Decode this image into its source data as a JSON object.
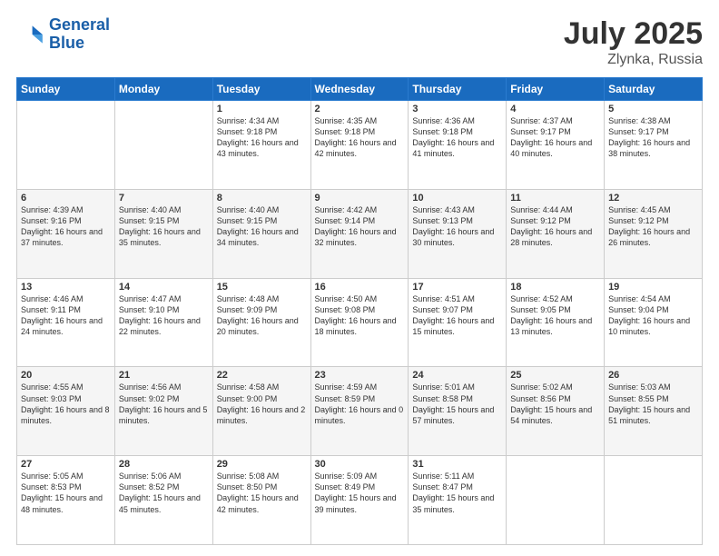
{
  "header": {
    "logo_line1": "General",
    "logo_line2": "Blue",
    "title": "July 2025",
    "location": "Zlynka, Russia"
  },
  "weekdays": [
    "Sunday",
    "Monday",
    "Tuesday",
    "Wednesday",
    "Thursday",
    "Friday",
    "Saturday"
  ],
  "weeks": [
    [
      {
        "day": "",
        "sunrise": "",
        "sunset": "",
        "daylight": ""
      },
      {
        "day": "",
        "sunrise": "",
        "sunset": "",
        "daylight": ""
      },
      {
        "day": "1",
        "sunrise": "Sunrise: 4:34 AM",
        "sunset": "Sunset: 9:18 PM",
        "daylight": "Daylight: 16 hours and 43 minutes."
      },
      {
        "day": "2",
        "sunrise": "Sunrise: 4:35 AM",
        "sunset": "Sunset: 9:18 PM",
        "daylight": "Daylight: 16 hours and 42 minutes."
      },
      {
        "day": "3",
        "sunrise": "Sunrise: 4:36 AM",
        "sunset": "Sunset: 9:18 PM",
        "daylight": "Daylight: 16 hours and 41 minutes."
      },
      {
        "day": "4",
        "sunrise": "Sunrise: 4:37 AM",
        "sunset": "Sunset: 9:17 PM",
        "daylight": "Daylight: 16 hours and 40 minutes."
      },
      {
        "day": "5",
        "sunrise": "Sunrise: 4:38 AM",
        "sunset": "Sunset: 9:17 PM",
        "daylight": "Daylight: 16 hours and 38 minutes."
      }
    ],
    [
      {
        "day": "6",
        "sunrise": "Sunrise: 4:39 AM",
        "sunset": "Sunset: 9:16 PM",
        "daylight": "Daylight: 16 hours and 37 minutes."
      },
      {
        "day": "7",
        "sunrise": "Sunrise: 4:40 AM",
        "sunset": "Sunset: 9:15 PM",
        "daylight": "Daylight: 16 hours and 35 minutes."
      },
      {
        "day": "8",
        "sunrise": "Sunrise: 4:40 AM",
        "sunset": "Sunset: 9:15 PM",
        "daylight": "Daylight: 16 hours and 34 minutes."
      },
      {
        "day": "9",
        "sunrise": "Sunrise: 4:42 AM",
        "sunset": "Sunset: 9:14 PM",
        "daylight": "Daylight: 16 hours and 32 minutes."
      },
      {
        "day": "10",
        "sunrise": "Sunrise: 4:43 AM",
        "sunset": "Sunset: 9:13 PM",
        "daylight": "Daylight: 16 hours and 30 minutes."
      },
      {
        "day": "11",
        "sunrise": "Sunrise: 4:44 AM",
        "sunset": "Sunset: 9:12 PM",
        "daylight": "Daylight: 16 hours and 28 minutes."
      },
      {
        "day": "12",
        "sunrise": "Sunrise: 4:45 AM",
        "sunset": "Sunset: 9:12 PM",
        "daylight": "Daylight: 16 hours and 26 minutes."
      }
    ],
    [
      {
        "day": "13",
        "sunrise": "Sunrise: 4:46 AM",
        "sunset": "Sunset: 9:11 PM",
        "daylight": "Daylight: 16 hours and 24 minutes."
      },
      {
        "day": "14",
        "sunrise": "Sunrise: 4:47 AM",
        "sunset": "Sunset: 9:10 PM",
        "daylight": "Daylight: 16 hours and 22 minutes."
      },
      {
        "day": "15",
        "sunrise": "Sunrise: 4:48 AM",
        "sunset": "Sunset: 9:09 PM",
        "daylight": "Daylight: 16 hours and 20 minutes."
      },
      {
        "day": "16",
        "sunrise": "Sunrise: 4:50 AM",
        "sunset": "Sunset: 9:08 PM",
        "daylight": "Daylight: 16 hours and 18 minutes."
      },
      {
        "day": "17",
        "sunrise": "Sunrise: 4:51 AM",
        "sunset": "Sunset: 9:07 PM",
        "daylight": "Daylight: 16 hours and 15 minutes."
      },
      {
        "day": "18",
        "sunrise": "Sunrise: 4:52 AM",
        "sunset": "Sunset: 9:05 PM",
        "daylight": "Daylight: 16 hours and 13 minutes."
      },
      {
        "day": "19",
        "sunrise": "Sunrise: 4:54 AM",
        "sunset": "Sunset: 9:04 PM",
        "daylight": "Daylight: 16 hours and 10 minutes."
      }
    ],
    [
      {
        "day": "20",
        "sunrise": "Sunrise: 4:55 AM",
        "sunset": "Sunset: 9:03 PM",
        "daylight": "Daylight: 16 hours and 8 minutes."
      },
      {
        "day": "21",
        "sunrise": "Sunrise: 4:56 AM",
        "sunset": "Sunset: 9:02 PM",
        "daylight": "Daylight: 16 hours and 5 minutes."
      },
      {
        "day": "22",
        "sunrise": "Sunrise: 4:58 AM",
        "sunset": "Sunset: 9:00 PM",
        "daylight": "Daylight: 16 hours and 2 minutes."
      },
      {
        "day": "23",
        "sunrise": "Sunrise: 4:59 AM",
        "sunset": "Sunset: 8:59 PM",
        "daylight": "Daylight: 16 hours and 0 minutes."
      },
      {
        "day": "24",
        "sunrise": "Sunrise: 5:01 AM",
        "sunset": "Sunset: 8:58 PM",
        "daylight": "Daylight: 15 hours and 57 minutes."
      },
      {
        "day": "25",
        "sunrise": "Sunrise: 5:02 AM",
        "sunset": "Sunset: 8:56 PM",
        "daylight": "Daylight: 15 hours and 54 minutes."
      },
      {
        "day": "26",
        "sunrise": "Sunrise: 5:03 AM",
        "sunset": "Sunset: 8:55 PM",
        "daylight": "Daylight: 15 hours and 51 minutes."
      }
    ],
    [
      {
        "day": "27",
        "sunrise": "Sunrise: 5:05 AM",
        "sunset": "Sunset: 8:53 PM",
        "daylight": "Daylight: 15 hours and 48 minutes."
      },
      {
        "day": "28",
        "sunrise": "Sunrise: 5:06 AM",
        "sunset": "Sunset: 8:52 PM",
        "daylight": "Daylight: 15 hours and 45 minutes."
      },
      {
        "day": "29",
        "sunrise": "Sunrise: 5:08 AM",
        "sunset": "Sunset: 8:50 PM",
        "daylight": "Daylight: 15 hours and 42 minutes."
      },
      {
        "day": "30",
        "sunrise": "Sunrise: 5:09 AM",
        "sunset": "Sunset: 8:49 PM",
        "daylight": "Daylight: 15 hours and 39 minutes."
      },
      {
        "day": "31",
        "sunrise": "Sunrise: 5:11 AM",
        "sunset": "Sunset: 8:47 PM",
        "daylight": "Daylight: 15 hours and 35 minutes."
      },
      {
        "day": "",
        "sunrise": "",
        "sunset": "",
        "daylight": ""
      },
      {
        "day": "",
        "sunrise": "",
        "sunset": "",
        "daylight": ""
      }
    ]
  ]
}
